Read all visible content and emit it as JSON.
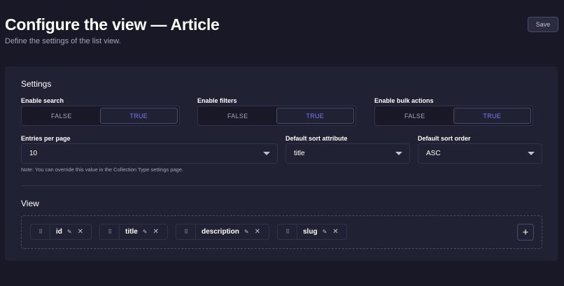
{
  "header": {
    "title": "Configure the view — Article",
    "subtitle": "Define the settings of the list view.",
    "save_label": "Save"
  },
  "settings": {
    "title": "Settings",
    "enable_search": {
      "label": "Enable search",
      "off": "FALSE",
      "on": "TRUE",
      "value": true
    },
    "enable_filters": {
      "label": "Enable filters",
      "off": "FALSE",
      "on": "TRUE",
      "value": true
    },
    "enable_bulk_actions": {
      "label": "Enable bulk actions",
      "off": "FALSE",
      "on": "TRUE",
      "value": true
    },
    "entries_per_page": {
      "label": "Entries per page",
      "value": "10"
    },
    "default_sort_attribute": {
      "label": "Default sort attribute",
      "value": "title"
    },
    "default_sort_order": {
      "label": "Default sort order",
      "value": "ASC"
    },
    "note": "Note: You can override this value in the Collection Type settings page."
  },
  "view": {
    "title": "View",
    "fields": [
      {
        "name": "id"
      },
      {
        "name": "title"
      },
      {
        "name": "description"
      },
      {
        "name": "slug"
      }
    ],
    "add_label": "+"
  },
  "icons": {
    "drag": "drag-handle-icon",
    "edit": "pencil-icon",
    "remove": "close-icon",
    "caret": "chevron-down-icon"
  },
  "colors": {
    "background": "#181826",
    "card": "#212134",
    "border": "#32324d",
    "accent": "#7b79ff",
    "muted_text": "#a5a5ba"
  }
}
